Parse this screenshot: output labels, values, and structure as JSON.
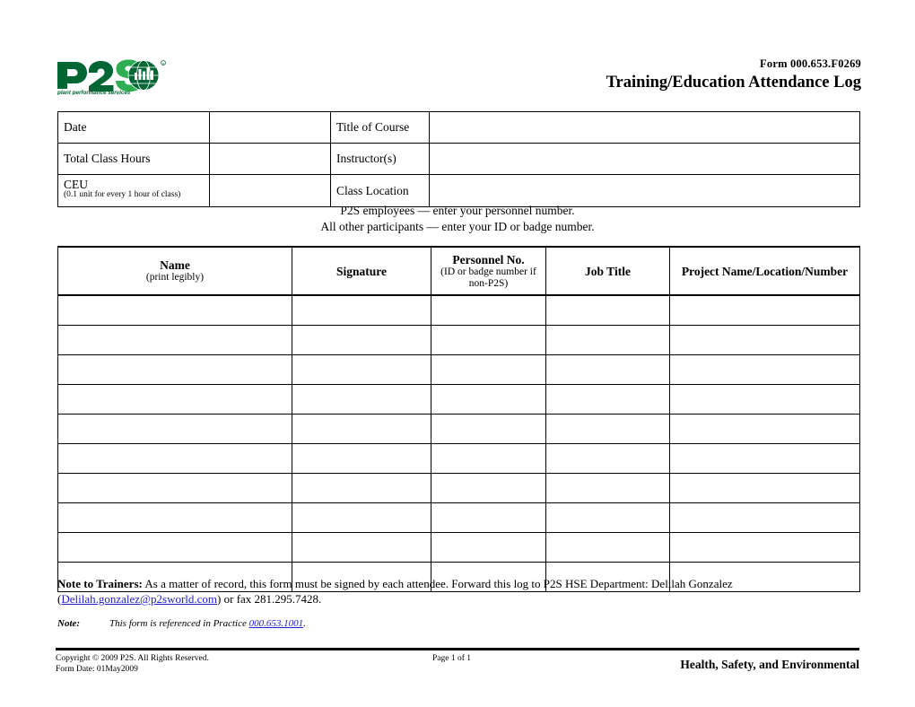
{
  "header": {
    "logo_alt": "P2S plant performance services",
    "logo_mark": "P2S",
    "logo_tagline": "plant performance services",
    "logo_color_dark": "#006633",
    "logo_color_light": "#2eae52",
    "form_number": "Form 000.653.F0269",
    "document_title": "Training/Education Attendance Log"
  },
  "info_table": {
    "rows": [
      {
        "label_left": "Date",
        "value_left": "",
        "label_right": "Title of Course",
        "value_right": ""
      },
      {
        "label_left": "Total Class Hours",
        "value_left": "",
        "label_right": "Instructor(s)",
        "value_right": ""
      },
      {
        "label_left": "CEU",
        "label_left_sub": "(0.1 unit for every 1 hour of class)",
        "value_left": "",
        "label_right": "Class Location",
        "value_right": ""
      }
    ]
  },
  "instructions": {
    "line1": "P2S employees — enter your personnel number.",
    "line2": "All other participants — enter your ID or badge number."
  },
  "attendance_table": {
    "columns": [
      {
        "title": "Name",
        "sub": "(print legibly)"
      },
      {
        "title": "Signature",
        "sub": ""
      },
      {
        "title": "Personnel No.",
        "sub": "(ID or badge number if non-P2S)"
      },
      {
        "title": "Job Title",
        "sub": ""
      },
      {
        "title": "Project Name/Location/Number",
        "sub": ""
      }
    ],
    "row_count": 10,
    "rows": [
      [
        "",
        "",
        "",
        "",
        ""
      ],
      [
        "",
        "",
        "",
        "",
        ""
      ],
      [
        "",
        "",
        "",
        "",
        ""
      ],
      [
        "",
        "",
        "",
        "",
        ""
      ],
      [
        "",
        "",
        "",
        "",
        ""
      ],
      [
        "",
        "",
        "",
        "",
        ""
      ],
      [
        "",
        "",
        "",
        "",
        ""
      ],
      [
        "",
        "",
        "",
        "",
        ""
      ],
      [
        "",
        "",
        "",
        "",
        ""
      ],
      [
        "",
        "",
        "",
        "",
        ""
      ]
    ]
  },
  "notes": {
    "trainers_label": "Note to Trainers:",
    "trainers_text_1": "As a matter of record, this form must be signed by each attendee.  Forward this log to P2S HSE Department: Delilah Gonzalez",
    "trainers_paren_open": "(",
    "trainers_email": "Delilah.gonzalez@p2sworld.com",
    "trainers_text_2": ") or fax 281.295.7428.",
    "practice_label": "Note:",
    "practice_text": "This form is referenced in Practice ",
    "practice_ref": "000.653.1001",
    "practice_period": "."
  },
  "footer": {
    "copyright": "Copyright © 2009 P2S.  All Rights Reserved.",
    "form_date": "Form Date: 01May2009",
    "page_number": "Page 1 of 1",
    "department": "Health, Safety, and Environmental"
  },
  "colors": {
    "link": "#2222cc",
    "rule": "#000000",
    "brand_green_dark": "#006633",
    "brand_green_light": "#2eae52"
  }
}
